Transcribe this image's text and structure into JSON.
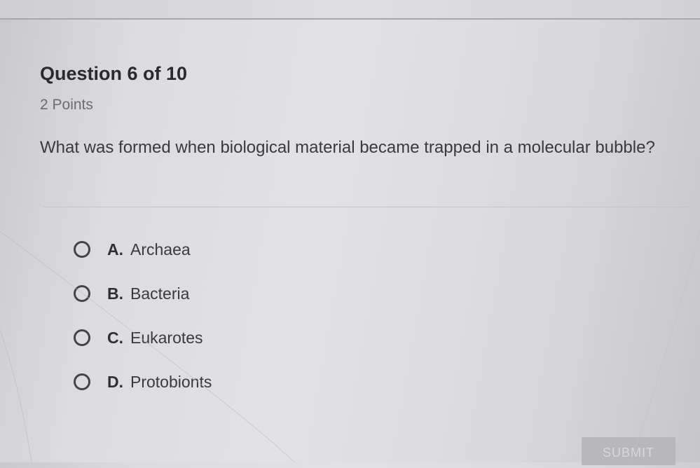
{
  "quiz": {
    "question_title": "Question 6 of 10",
    "points": "2 Points",
    "question_text": "What was formed when biological material became trapped in a molecular bubble?",
    "options": [
      {
        "letter": "A.",
        "text": "Archaea",
        "selected": false
      },
      {
        "letter": "B.",
        "text": "Bacteria",
        "selected": false
      },
      {
        "letter": "C.",
        "text": "Eukarotes",
        "selected": false
      },
      {
        "letter": "D.",
        "text": "Protobionts",
        "selected": false
      }
    ],
    "submit_label": "SUBMIT"
  },
  "colors": {
    "text_primary": "#2a2a2e",
    "text_secondary": "#6d6d71",
    "radio_border": "#444448",
    "submit_bg": "#b8b8bb"
  },
  "icons": {
    "radio": "radio-unchecked-icon"
  }
}
